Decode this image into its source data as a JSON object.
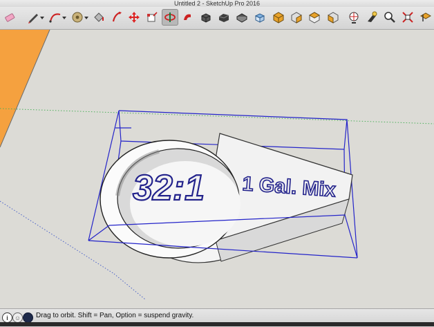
{
  "window": {
    "title": "Untitled 2 - SketchUp Pro 2016"
  },
  "toolbar": {
    "tools": [
      {
        "icon": "eraser-icon"
      },
      {
        "icon": "pencil-icon"
      },
      {
        "icon": "arc-icon"
      },
      {
        "icon": "tape-measure-icon"
      },
      {
        "icon": "paint-bucket-icon"
      },
      {
        "icon": "push-pull-icon"
      },
      {
        "icon": "move-icon"
      },
      {
        "icon": "scale-icon"
      },
      {
        "icon": "orbit-icon"
      },
      {
        "icon": "follow-me-icon"
      },
      {
        "icon": "component-icon"
      },
      {
        "icon": "warehouse-icon"
      },
      {
        "icon": "top-view-icon"
      },
      {
        "icon": "iso-view-icon"
      },
      {
        "icon": "front-view-icon"
      },
      {
        "icon": "right-view-icon"
      },
      {
        "icon": "back-view-icon"
      },
      {
        "icon": "left-view-icon"
      },
      {
        "icon": "look-around-icon"
      },
      {
        "icon": "walk-icon"
      },
      {
        "icon": "zoom-icon"
      },
      {
        "icon": "zoom-extents-icon"
      },
      {
        "icon": "section-plane-icon"
      }
    ]
  },
  "model": {
    "ratio_text": "32:1",
    "mix_text": "1 Gal. Mix"
  },
  "status": {
    "text": "Drag to orbit. Shift = Pan, Option = suspend gravity."
  }
}
